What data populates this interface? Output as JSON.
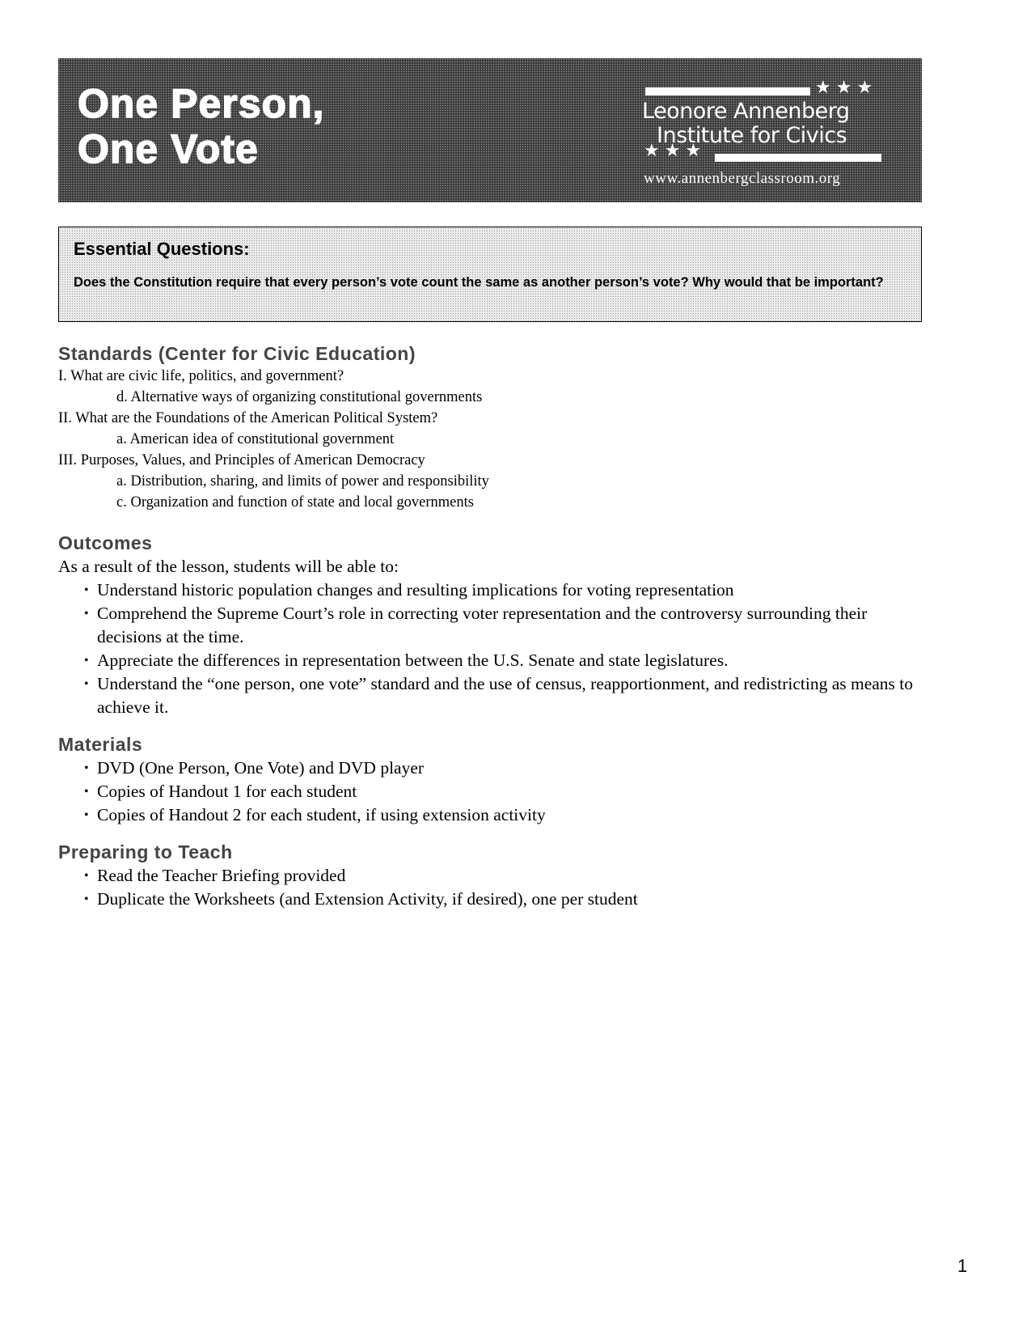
{
  "banner": {
    "title_line1": "One Person,",
    "title_line2": "One Vote",
    "logo": {
      "name_line1": "Leonore Annenberg",
      "name_line2": "Institute for Civics",
      "stars": "★★★",
      "url": "www.annenbergclassroom.org"
    }
  },
  "essential_questions": {
    "title": "Essential Questions:",
    "text": "Does the Constitution require that every person’s vote count the same as another person’s vote? Why would that be important?"
  },
  "standards": {
    "heading": "Standards (Center for Civic Education)",
    "items": [
      {
        "text": "I. What are civic life, politics, and government?",
        "level": 0
      },
      {
        "text": "d. Alternative ways of organizing constitutional governments",
        "level": 1
      },
      {
        "text": "II. What are the Foundations of the American Political System?",
        "level": 0
      },
      {
        "text": "a. American idea of constitutional government",
        "level": 1
      },
      {
        "text": "III. Purposes, Values, and Principles of American Democracy",
        "level": 0
      },
      {
        "text": "a. Distribution, sharing, and limits of power and responsibility",
        "level": 1
      },
      {
        "text": "c. Organization and function of state and local governments",
        "level": 1
      }
    ]
  },
  "outcomes": {
    "heading": "Outcomes",
    "intro": "As a result of the lesson, students will be able to:",
    "items": [
      "Understand historic population changes and resulting implications for voting representation",
      "Comprehend the Supreme Court’s role in correcting voter representation and the controversy surrounding their decisions at the time.",
      "Appreciate the differences in representation between the U.S. Senate and state legislatures.",
      "Understand the “one person, one vote” standard and the use of census, reapportionment, and redistricting as means to achieve it."
    ]
  },
  "materials": {
    "heading": "Materials",
    "items": [
      "DVD (One Person, One Vote) and DVD player",
      "Copies of Handout 1 for each student",
      "Copies of Handout 2 for each student, if using extension activity"
    ]
  },
  "preparing": {
    "heading": "Preparing to Teach",
    "items": [
      "Read the Teacher Briefing provided",
      "Duplicate the Worksheets (and Extension Activity, if desired), one per student"
    ]
  },
  "page_number": "1"
}
